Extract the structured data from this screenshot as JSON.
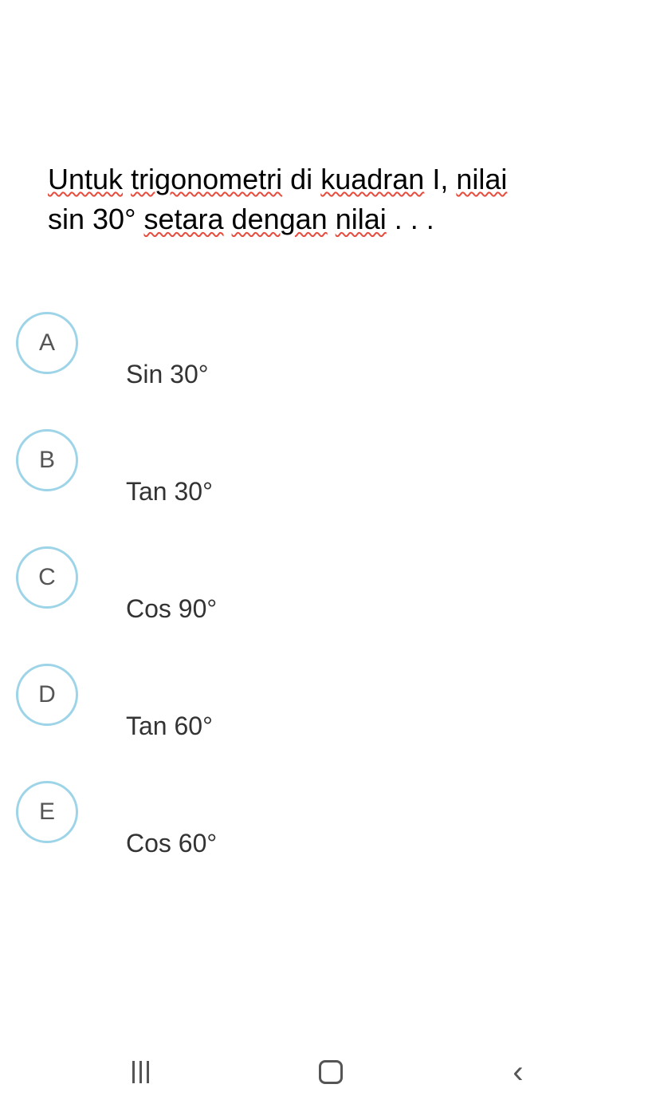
{
  "question": {
    "line1_parts": {
      "w1": "Untuk",
      "w2": "trigonometri",
      "w3": "di",
      "w4": "kuadran",
      "w5": "I,",
      "w6": "nilai"
    },
    "line2_parts": {
      "pre": "sin 30° ",
      "w1": "setara",
      "w2": "dengan",
      "w3": "nilai",
      "post": " . . ."
    }
  },
  "options": [
    {
      "letter": "A",
      "text": "Sin 30°"
    },
    {
      "letter": "B",
      "text": "Tan 30°"
    },
    {
      "letter": "C",
      "text": "Cos 90°"
    },
    {
      "letter": "D",
      "text": "Tan 60°"
    },
    {
      "letter": "E",
      "text": "Cos 60°"
    }
  ]
}
